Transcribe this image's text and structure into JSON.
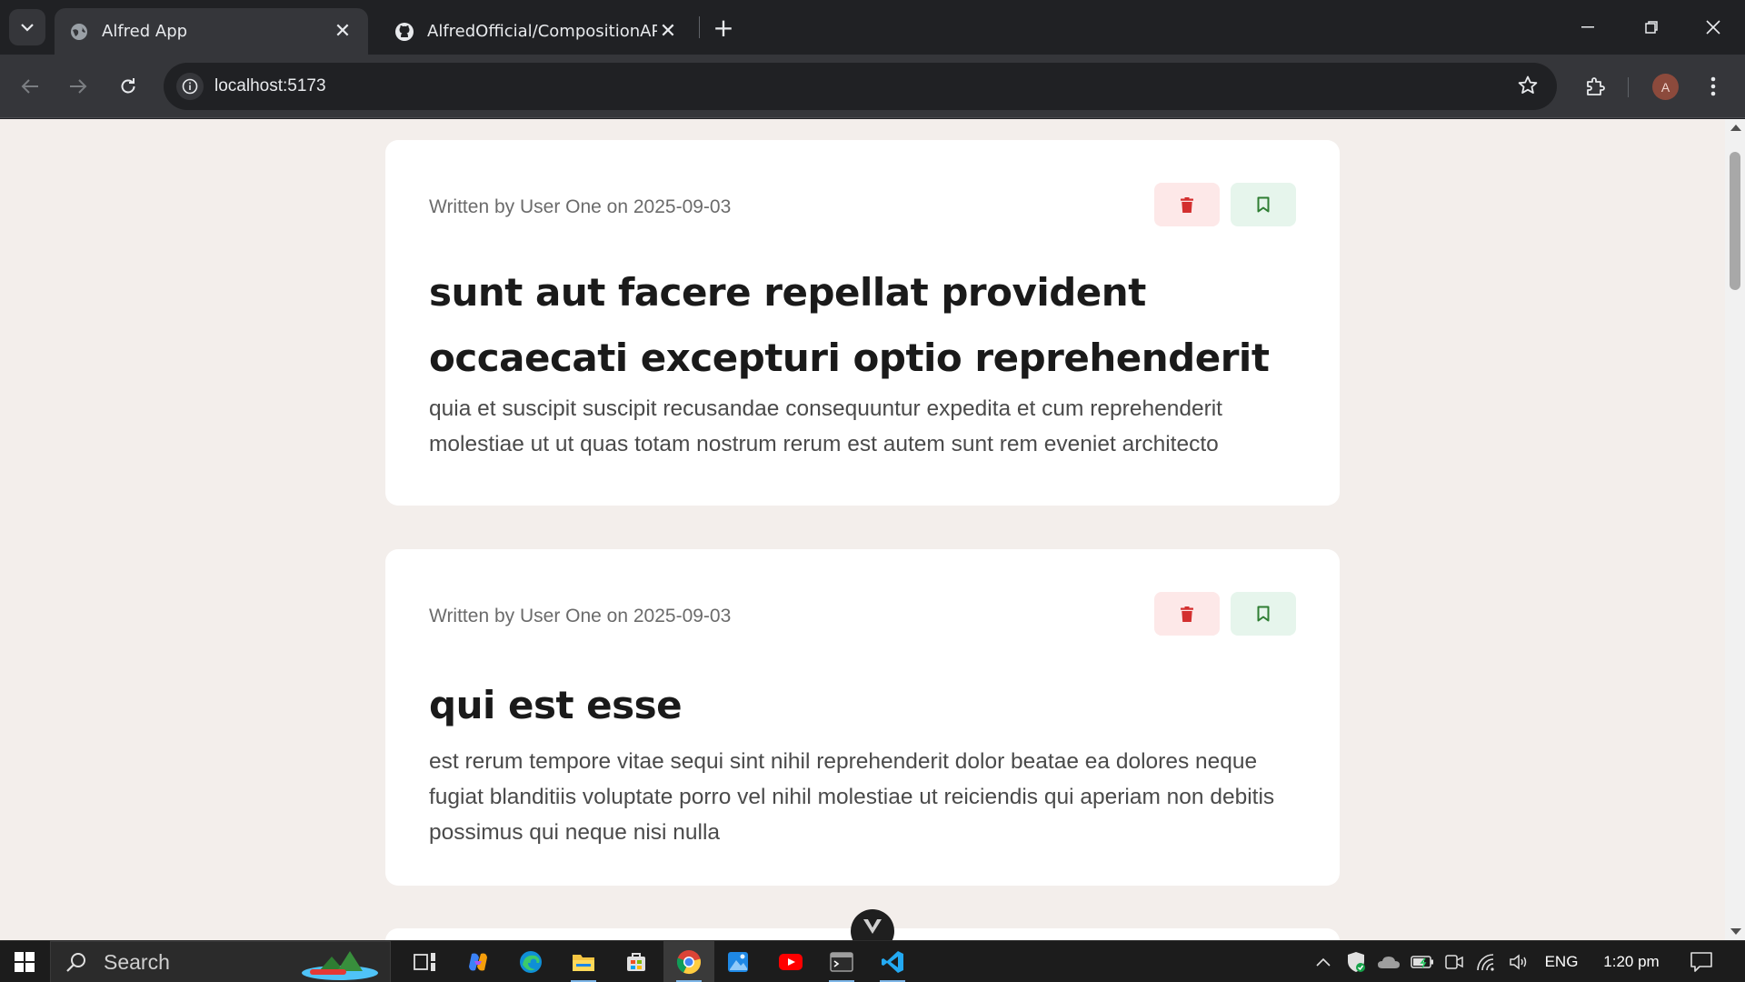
{
  "browser": {
    "tabs": [
      {
        "title": "Alfred App",
        "active": true,
        "icon": "globe-icon"
      },
      {
        "title": "AlfredOfficial/CompositionAPI",
        "active": false,
        "icon": "github-icon"
      }
    ],
    "url": "localhost:5173",
    "profile_initial": "A"
  },
  "posts": [
    {
      "meta": "Written by User One on 2025-09-03",
      "title": "sunt aut facere repellat provident occaecati excepturi optio reprehenderit",
      "body": "quia et suscipit suscipit recusandae consequuntur expedita et cum reprehenderit molestiae ut ut quas totam nostrum rerum est autem sunt rem eveniet architecto"
    },
    {
      "meta": "Written by User One on 2025-09-03",
      "title": "qui est esse",
      "body": "est rerum tempore vitae sequi sint nihil reprehenderit dolor beatae ea dolores neque fugiat blanditiis voluptate porro vel nihil molestiae ut reiciendis qui aperiam non debitis possimus qui neque nisi nulla"
    }
  ],
  "colors": {
    "delete_icon": "#d32f2f",
    "delete_bg": "#fde8e8",
    "save_icon": "#2e7d32",
    "save_bg": "#e6f5ec",
    "page_bg": "#f3eeeb"
  },
  "taskbar": {
    "search_label": "Search",
    "language": "ENG",
    "time": "1:20 pm"
  }
}
